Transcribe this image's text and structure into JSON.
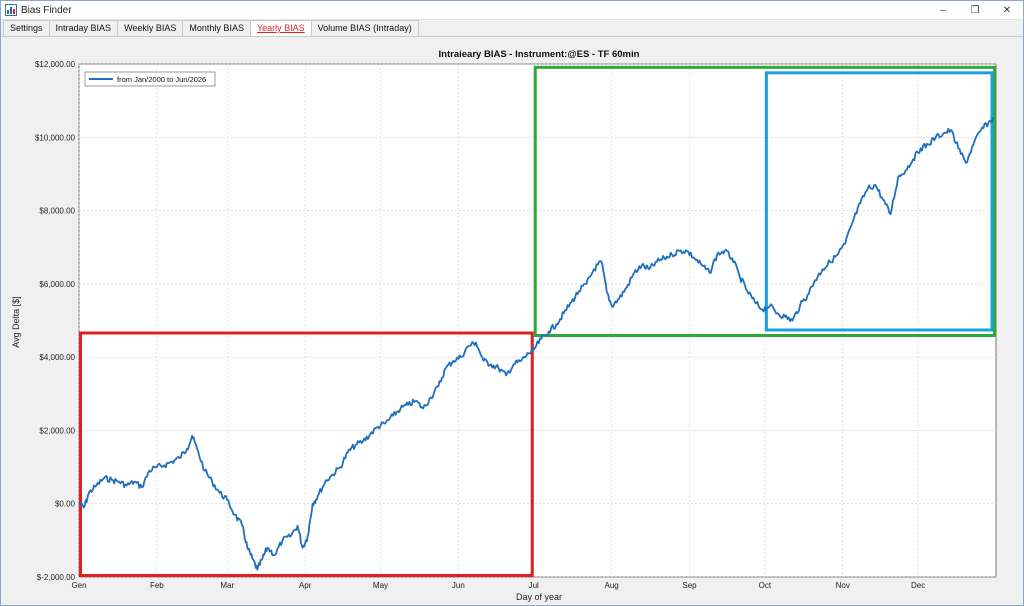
{
  "window": {
    "title": "Bias Finder",
    "minimize_glyph": "–",
    "restore_glyph": "❐",
    "close_glyph": "✕"
  },
  "tabs": [
    {
      "label": "Settings",
      "active": false
    },
    {
      "label": "Intraday BIAS",
      "active": false
    },
    {
      "label": "Weekly BIAS",
      "active": false
    },
    {
      "label": "Monthly BIAS",
      "active": false
    },
    {
      "label": "Yearly BIAS",
      "active": true
    },
    {
      "label": "Volume BIAS (Intraday)",
      "active": false
    }
  ],
  "colors": {
    "line": "#1f6fbf",
    "box_red": "#e02020",
    "box_green": "#2ea836",
    "box_blue": "#1aa0e0",
    "active_tab": "#e02020"
  },
  "chart_data": {
    "type": "line",
    "title": "Intraieary BIAS - Instrument:@ES - TF 60min",
    "xlabel": "Day of year",
    "ylabel": "Avg Delta [$]",
    "legend": "from Jan/2000 to Jun/2026",
    "legend_position": "top-left",
    "grid": true,
    "xlim": [
      0,
      365
    ],
    "ylim": [
      -2000,
      12000
    ],
    "x_ticks": [
      {
        "label": "Gen",
        "day": 0
      },
      {
        "label": "Feb",
        "day": 31
      },
      {
        "label": "Mar",
        "day": 59
      },
      {
        "label": "Apr",
        "day": 90
      },
      {
        "label": "May",
        "day": 120
      },
      {
        "label": "Jun",
        "day": 151
      },
      {
        "label": "Jul",
        "day": 181
      },
      {
        "label": "Aug",
        "day": 212
      },
      {
        "label": "Sep",
        "day": 243
      },
      {
        "label": "Oct",
        "day": 273
      },
      {
        "label": "Nov",
        "day": 304
      },
      {
        "label": "Dec",
        "day": 334
      }
    ],
    "y_ticks": [
      {
        "label": "$-2,000.00",
        "value": -2000
      },
      {
        "label": "$0.00",
        "value": 0
      },
      {
        "label": "$2,000.00",
        "value": 2000
      },
      {
        "label": "$4,000.00",
        "value": 4000
      },
      {
        "label": "$6,000.00",
        "value": 6000
      },
      {
        "label": "$8,000.00",
        "value": 8000
      },
      {
        "label": "$10,000.00",
        "value": 10000
      },
      {
        "label": "$12,000.00",
        "value": 12000
      }
    ],
    "series": [
      {
        "x": [
          0,
          2,
          4,
          7,
          10,
          13,
          16,
          19,
          22,
          25,
          28,
          31,
          34,
          37,
          40,
          43,
          45,
          47,
          50,
          53,
          56,
          59,
          62,
          65,
          67,
          69,
          71,
          73,
          75,
          78,
          81,
          84,
          87,
          89,
          91,
          93,
          95,
          98,
          101,
          104,
          107,
          110,
          113,
          116,
          119,
          122,
          125,
          128,
          131,
          134,
          137,
          140,
          143,
          146,
          149,
          152,
          155,
          158,
          161,
          164,
          167,
          170,
          173,
          176,
          179,
          181,
          184,
          187,
          190,
          193,
          196,
          199,
          202,
          205,
          208,
          210,
          212,
          215,
          218,
          221,
          224,
          227,
          230,
          233,
          236,
          239,
          242,
          245,
          248,
          251,
          254,
          257,
          260,
          263,
          266,
          269,
          272,
          275,
          278,
          281,
          284,
          287,
          290,
          293,
          296,
          299,
          302,
          305,
          308,
          311,
          314,
          317,
          320,
          323,
          326,
          329,
          332,
          335,
          338,
          341,
          344,
          347,
          350,
          353,
          356,
          359,
          362,
          364
        ],
        "y": [
          0,
          -100,
          300,
          500,
          700,
          650,
          600,
          500,
          600,
          450,
          900,
          1000,
          1050,
          1150,
          1250,
          1500,
          1850,
          1500,
          900,
          600,
          300,
          100,
          -300,
          -600,
          -1200,
          -1500,
          -1800,
          -1500,
          -1200,
          -1400,
          -1000,
          -900,
          -600,
          -1200,
          -900,
          0,
          200,
          600,
          800,
          1000,
          1400,
          1600,
          1700,
          1900,
          2100,
          2200,
          2400,
          2600,
          2700,
          2800,
          2600,
          2900,
          3200,
          3700,
          3900,
          4000,
          4300,
          4400,
          3900,
          3800,
          3700,
          3500,
          3800,
          3900,
          4100,
          4200,
          4500,
          4700,
          4900,
          5200,
          5500,
          5800,
          6000,
          6400,
          6600,
          5800,
          5400,
          5600,
          5900,
          6300,
          6500,
          6400,
          6600,
          6700,
          6800,
          6900,
          6900,
          6700,
          6500,
          6300,
          6800,
          6900,
          6700,
          6200,
          5800,
          5500,
          5300,
          5400,
          5200,
          5100,
          5000,
          5400,
          5700,
          6100,
          6400,
          6600,
          6800,
          7100,
          7700,
          8200,
          8600,
          8700,
          8300,
          7900,
          8900,
          9100,
          9400,
          9700,
          9800,
          10000,
          10100,
          10200,
          9700,
          9300,
          9800,
          10200,
          10400,
          10500
        ],
        "name": "from Jan/2000 to Jun/2026"
      }
    ],
    "highlight_boxes": [
      {
        "color": "red",
        "x0": 0,
        "x1": 181,
        "y0": -2000,
        "y1": 4700
      },
      {
        "color": "green",
        "x0": 181,
        "x1": 365,
        "y0": 4550,
        "y1": 11950
      },
      {
        "color": "blue",
        "x0": 273,
        "x1": 364,
        "y0": 4700,
        "y1": 11800
      }
    ]
  }
}
